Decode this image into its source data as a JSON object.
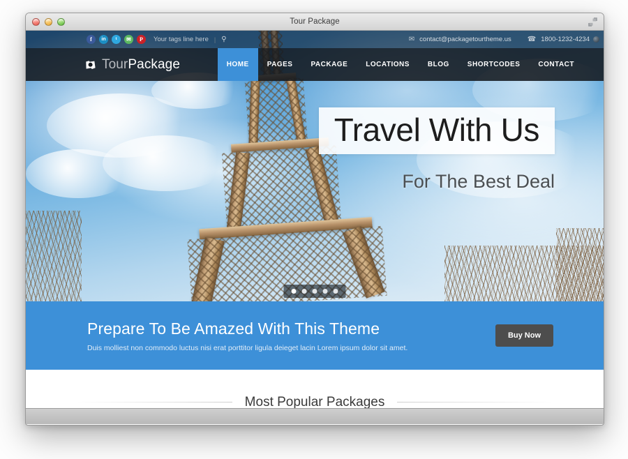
{
  "window": {
    "title": "Tour Package",
    "controls": [
      "close",
      "minimize",
      "maximize"
    ],
    "fullscreen_icon": "fullscreen-icon"
  },
  "topbar": {
    "social": [
      {
        "name": "facebook",
        "glyph": "f"
      },
      {
        "name": "linkedin",
        "glyph": "in"
      },
      {
        "name": "twitter",
        "glyph": "ᵗ"
      },
      {
        "name": "email",
        "glyph": "✉"
      },
      {
        "name": "pinterest",
        "glyph": "P"
      }
    ],
    "tagline": "Your tags line here",
    "separator": "|",
    "search_icon": "⚲",
    "email": "contact@packagetourtheme.us",
    "email_icon": "✉",
    "phone": "1800-1232-4234",
    "phone_icon": "☎"
  },
  "brand": {
    "name_part1": "Tour",
    "name_part2": "Package",
    "logo_icon": "camera-icon"
  },
  "nav": {
    "items": [
      {
        "label": "HOME",
        "active": true
      },
      {
        "label": "PAGES",
        "active": false
      },
      {
        "label": "PACKAGE",
        "active": false
      },
      {
        "label": "LOCATIONS",
        "active": false
      },
      {
        "label": "BLOG",
        "active": false
      },
      {
        "label": "SHORTCODES",
        "active": false
      },
      {
        "label": "CONTACT",
        "active": false
      }
    ]
  },
  "hero": {
    "title": "Travel With Us",
    "subtitle": "For The Best Deal",
    "image_alt": "eiffel-tower-photo",
    "slides": 5,
    "active_slide": 1
  },
  "cta": {
    "title": "Prepare To Be Amazed With This Theme",
    "subtitle": "Duis molliest non commodo luctus nisi erat porttitor ligula deieget lacin Lorem ipsum dolor sit amet.",
    "button_label": "Buy Now"
  },
  "packages": {
    "section_title": "Most Popular Packages"
  },
  "colors": {
    "accent_blue": "#3d90d8",
    "nav_dark": "#14191f",
    "button_dark": "#4d4d4d",
    "topbar_dark": "#0e1620"
  }
}
